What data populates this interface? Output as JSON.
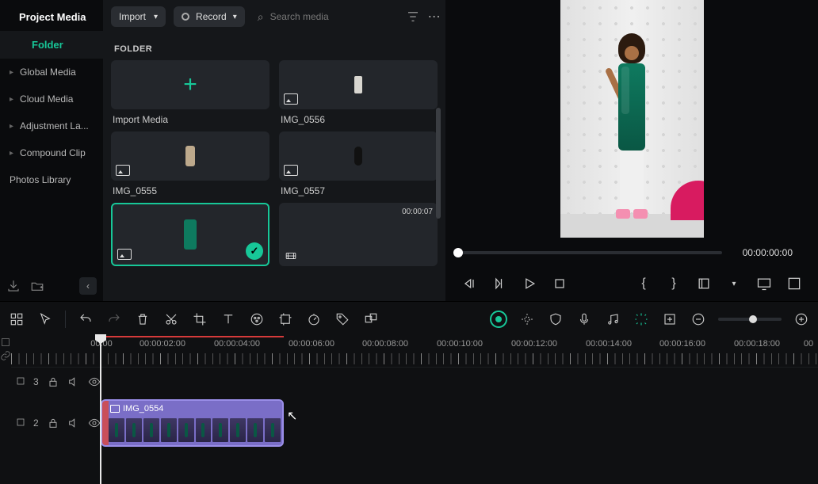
{
  "sidebar": {
    "title": "Project Media",
    "folder_label": "Folder",
    "items": [
      {
        "label": "Global Media"
      },
      {
        "label": "Cloud Media"
      },
      {
        "label": "Adjustment La..."
      },
      {
        "label": "Compound Clip"
      },
      {
        "label": "Photos Library"
      }
    ]
  },
  "media_panel": {
    "import_label": "Import",
    "record_label": "Record",
    "search_placeholder": "Search media",
    "folder_heading": "FOLDER",
    "import_media_label": "Import Media",
    "items": [
      {
        "label": "IMG_0556"
      },
      {
        "label": "IMG_0555"
      },
      {
        "label": "IMG_0557"
      }
    ],
    "selected_duration": "00:00:07"
  },
  "preview": {
    "timecode": "00:00:00:00"
  },
  "timeline": {
    "labels": [
      "00:00",
      "00:00:02:00",
      "00:00:04:00",
      "00:00:06:00",
      "00:00:08:00",
      "00:00:10:00",
      "00:00:12:00",
      "00:00:14:00",
      "00:00:16:00",
      "00:00:18:00",
      "00"
    ],
    "tracks": {
      "a_index": "3",
      "b_index": "2"
    },
    "clip_label": "IMG_0554"
  }
}
